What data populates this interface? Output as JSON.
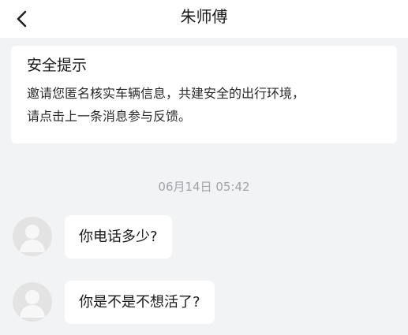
{
  "header": {
    "title": "朱师傅",
    "back_icon": "chevron-left-icon"
  },
  "safety_notice": {
    "title": "安全提示",
    "line1": "邀请您匿名核实车辆信息，共建安全的出行环境，",
    "line2": "请点击上一条消息参与反馈。"
  },
  "chat": {
    "timestamp": "06月14日 05:42",
    "messages": [
      {
        "text": "你电话多少?",
        "avatar_icon": "default-avatar-icon"
      },
      {
        "text": "你是不是不想活了?",
        "avatar_icon": "default-avatar-icon"
      }
    ]
  },
  "colors": {
    "background": "#f2f3f5",
    "card": "#ffffff",
    "timestamp": "#a0a3a8",
    "avatar": "#e3e3e3"
  }
}
